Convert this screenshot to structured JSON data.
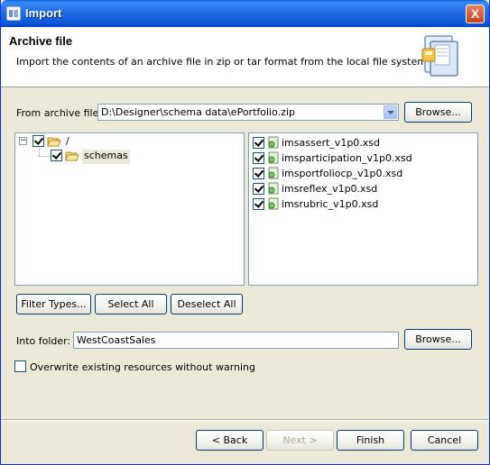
{
  "window": {
    "title": "Import",
    "close_label": "X"
  },
  "banner": {
    "title": "Archive file",
    "description": "Import the contents of an archive file in zip or tar format from the local file system."
  },
  "source": {
    "label": "From archive file:",
    "value": "D:\\Designer\\schema data\\ePortfolio.zip",
    "browse_label": "Browse..."
  },
  "tree": {
    "root_label": "/",
    "child_label": "schemas"
  },
  "files": [
    "imsassert_v1p0.xsd",
    "imsparticipation_v1p0.xsd",
    "imsportfoliocp_v1p0.xsd",
    "imsreflex_v1p0.xsd",
    "imsrubric_v1p0.xsd"
  ],
  "selection_buttons": {
    "filter": "Filter Types...",
    "select_all": "Select All",
    "deselect_all": "Deselect All"
  },
  "destination": {
    "label": "Into folder:",
    "value": "WestCoastSales",
    "browse_label": "Browse..."
  },
  "overwrite": {
    "label": "Overwrite existing resources without warning",
    "checked": false
  },
  "footer": {
    "back": "< Back",
    "next": "Next >",
    "finish": "Finish",
    "cancel": "Cancel"
  }
}
